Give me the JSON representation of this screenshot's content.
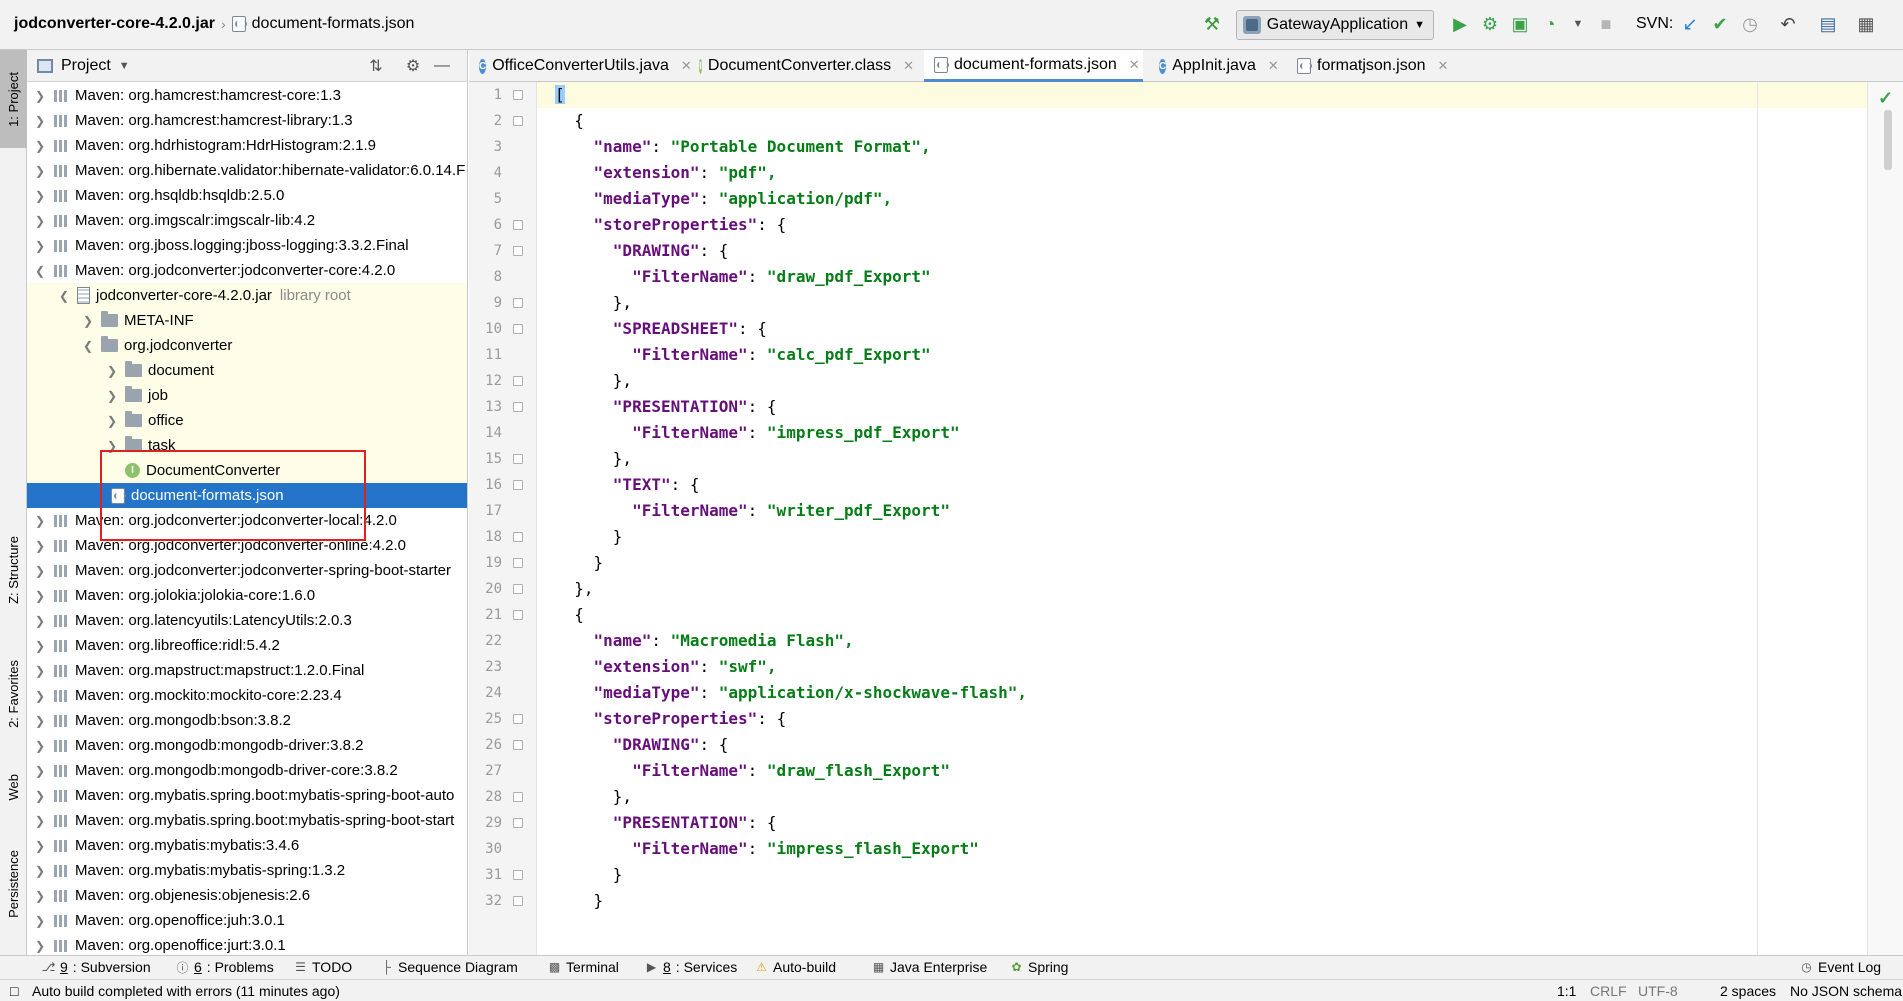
{
  "breadcrumb": {
    "jar": "jodconverter-core-4.2.0.jar",
    "file": "document-formats.json"
  },
  "toolbar": {
    "run_config": "GatewayApplication",
    "svn_label": "SVN:"
  },
  "left_stripe": {
    "project": "1: Project",
    "structure": "Z: Structure",
    "favorites": "2: Favorites",
    "web": "Web",
    "persistence": "Persistence"
  },
  "project_panel": {
    "title": "Project",
    "tree": [
      {
        "label": "Maven: org.hamcrest:hamcrest-core:1.3"
      },
      {
        "label": "Maven: org.hamcrest:hamcrest-library:1.3"
      },
      {
        "label": "Maven: org.hdrhistogram:HdrHistogram:2.1.9"
      },
      {
        "label": "Maven: org.hibernate.validator:hibernate-validator:6.0.14.F"
      },
      {
        "label": "Maven: org.hsqldb:hsqldb:2.5.0"
      },
      {
        "label": "Maven: org.imgscalr:imgscalr-lib:4.2"
      },
      {
        "label": "Maven: org.jboss.logging:jboss-logging:3.3.2.Final"
      },
      {
        "label": "Maven: org.jodconverter:jodconverter-core:4.2.0"
      },
      {
        "label": "jodconverter-core-4.2.0.jar",
        "extra": "library root"
      },
      {
        "label": "META-INF"
      },
      {
        "label": "org.jodconverter"
      },
      {
        "label": "document"
      },
      {
        "label": "job"
      },
      {
        "label": "office"
      },
      {
        "label": "task"
      },
      {
        "label": "DocumentConverter"
      },
      {
        "label": "document-formats.json"
      },
      {
        "label": "Maven: org.jodconverter:jodconverter-local:4.2.0"
      },
      {
        "label": "Maven: org.jodconverter:jodconverter-online:4.2.0"
      },
      {
        "label": "Maven: org.jodconverter:jodconverter-spring-boot-starter"
      },
      {
        "label": "Maven: org.jolokia:jolokia-core:1.6.0"
      },
      {
        "label": "Maven: org.latencyutils:LatencyUtils:2.0.3"
      },
      {
        "label": "Maven: org.libreoffice:ridl:5.4.2"
      },
      {
        "label": "Maven: org.mapstruct:mapstruct:1.2.0.Final"
      },
      {
        "label": "Maven: org.mockito:mockito-core:2.23.4"
      },
      {
        "label": "Maven: org.mongodb:bson:3.8.2"
      },
      {
        "label": "Maven: org.mongodb:mongodb-driver:3.8.2"
      },
      {
        "label": "Maven: org.mongodb:mongodb-driver-core:3.8.2"
      },
      {
        "label": "Maven: org.mybatis.spring.boot:mybatis-spring-boot-auto"
      },
      {
        "label": "Maven: org.mybatis.spring.boot:mybatis-spring-boot-start"
      },
      {
        "label": "Maven: org.mybatis:mybatis:3.4.6"
      },
      {
        "label": "Maven: org.mybatis:mybatis-spring:1.3.2"
      },
      {
        "label": "Maven: org.objenesis:objenesis:2.6"
      },
      {
        "label": "Maven: org.openoffice:juh:3.0.1"
      },
      {
        "label": "Maven: org.openoffice:jurt:3.0.1"
      }
    ]
  },
  "editor": {
    "tabs": [
      {
        "label": "OfficeConverterUtils.java"
      },
      {
        "label": "DocumentConverter.class"
      },
      {
        "label": "document-formats.json"
      },
      {
        "label": "AppInit.java"
      },
      {
        "label": "formatjson.json"
      }
    ],
    "line_numbers": [
      "1",
      "2",
      "3",
      "4",
      "5",
      "6",
      "7",
      "8",
      "9",
      "10",
      "11",
      "12",
      "13",
      "14",
      "15",
      "16",
      "17",
      "18",
      "19",
      "20",
      "21",
      "22",
      "23",
      "24",
      "25",
      "26",
      "27",
      "28",
      "29",
      "30",
      "31",
      "32"
    ],
    "code": [
      [
        "[",
        "",
        "",
        ""
      ],
      [
        "  {",
        "",
        "",
        ""
      ],
      [
        "    ",
        "\"name\"",
        ": ",
        "\"Portable Document Format\","
      ],
      [
        "    ",
        "\"extension\"",
        ": ",
        "\"pdf\","
      ],
      [
        "    ",
        "\"mediaType\"",
        ": ",
        "\"application/pdf\","
      ],
      [
        "    ",
        "\"storeProperties\"",
        ": {",
        ""
      ],
      [
        "      ",
        "\"DRAWING\"",
        ": {",
        ""
      ],
      [
        "        ",
        "\"FilterName\"",
        ": ",
        "\"draw_pdf_Export\""
      ],
      [
        "      },",
        "",
        "",
        ""
      ],
      [
        "      ",
        "\"SPREADSHEET\"",
        ": {",
        ""
      ],
      [
        "        ",
        "\"FilterName\"",
        ": ",
        "\"calc_pdf_Export\""
      ],
      [
        "      },",
        "",
        "",
        ""
      ],
      [
        "      ",
        "\"PRESENTATION\"",
        ": {",
        ""
      ],
      [
        "        ",
        "\"FilterName\"",
        ": ",
        "\"impress_pdf_Export\""
      ],
      [
        "      },",
        "",
        "",
        ""
      ],
      [
        "      ",
        "\"TEXT\"",
        ": {",
        ""
      ],
      [
        "        ",
        "\"FilterName\"",
        ": ",
        "\"writer_pdf_Export\""
      ],
      [
        "      }",
        "",
        "",
        ""
      ],
      [
        "    }",
        "",
        "",
        ""
      ],
      [
        "  },",
        "",
        "",
        ""
      ],
      [
        "  {",
        "",
        "",
        ""
      ],
      [
        "    ",
        "\"name\"",
        ": ",
        "\"Macromedia Flash\","
      ],
      [
        "    ",
        "\"extension\"",
        ": ",
        "\"swf\","
      ],
      [
        "    ",
        "\"mediaType\"",
        ": ",
        "\"application/x-shockwave-flash\","
      ],
      [
        "    ",
        "\"storeProperties\"",
        ": {",
        ""
      ],
      [
        "      ",
        "\"DRAWING\"",
        ": {",
        ""
      ],
      [
        "        ",
        "\"FilterName\"",
        ": ",
        "\"draw_flash_Export\""
      ],
      [
        "      },",
        "",
        "",
        ""
      ],
      [
        "      ",
        "\"PRESENTATION\"",
        ": {",
        ""
      ],
      [
        "        ",
        "\"FilterName\"",
        ": ",
        "\"impress_flash_Export\""
      ],
      [
        "      }",
        "",
        "",
        ""
      ],
      [
        "    }",
        "",
        "",
        ""
      ]
    ]
  },
  "bottom_tools": [
    {
      "key": "9",
      "label": ": Subversion"
    },
    {
      "key": "6",
      "label": ": Problems"
    },
    {
      "key": "",
      "label": "TODO"
    },
    {
      "key": "",
      "label": "Sequence Diagram"
    },
    {
      "key": "",
      "label": "Terminal"
    },
    {
      "key": "8",
      "label": ": Services"
    },
    {
      "key": "",
      "label": "Auto-build"
    },
    {
      "key": "",
      "label": "Java Enterprise"
    },
    {
      "key": "",
      "label": "Spring"
    },
    {
      "key": "",
      "label": "Event Log"
    }
  ],
  "status": {
    "message": "Auto build completed with errors (11 minutes ago)",
    "position": "1:1",
    "line_sep": "CRLF",
    "encoding": "UTF-8",
    "indent": "2 spaces",
    "schema": "No JSON schema"
  },
  "colors": {
    "selection": "#2475c9",
    "highlight_box": "#e02020",
    "json_key": "#660e7a",
    "json_string": "#067d17"
  }
}
